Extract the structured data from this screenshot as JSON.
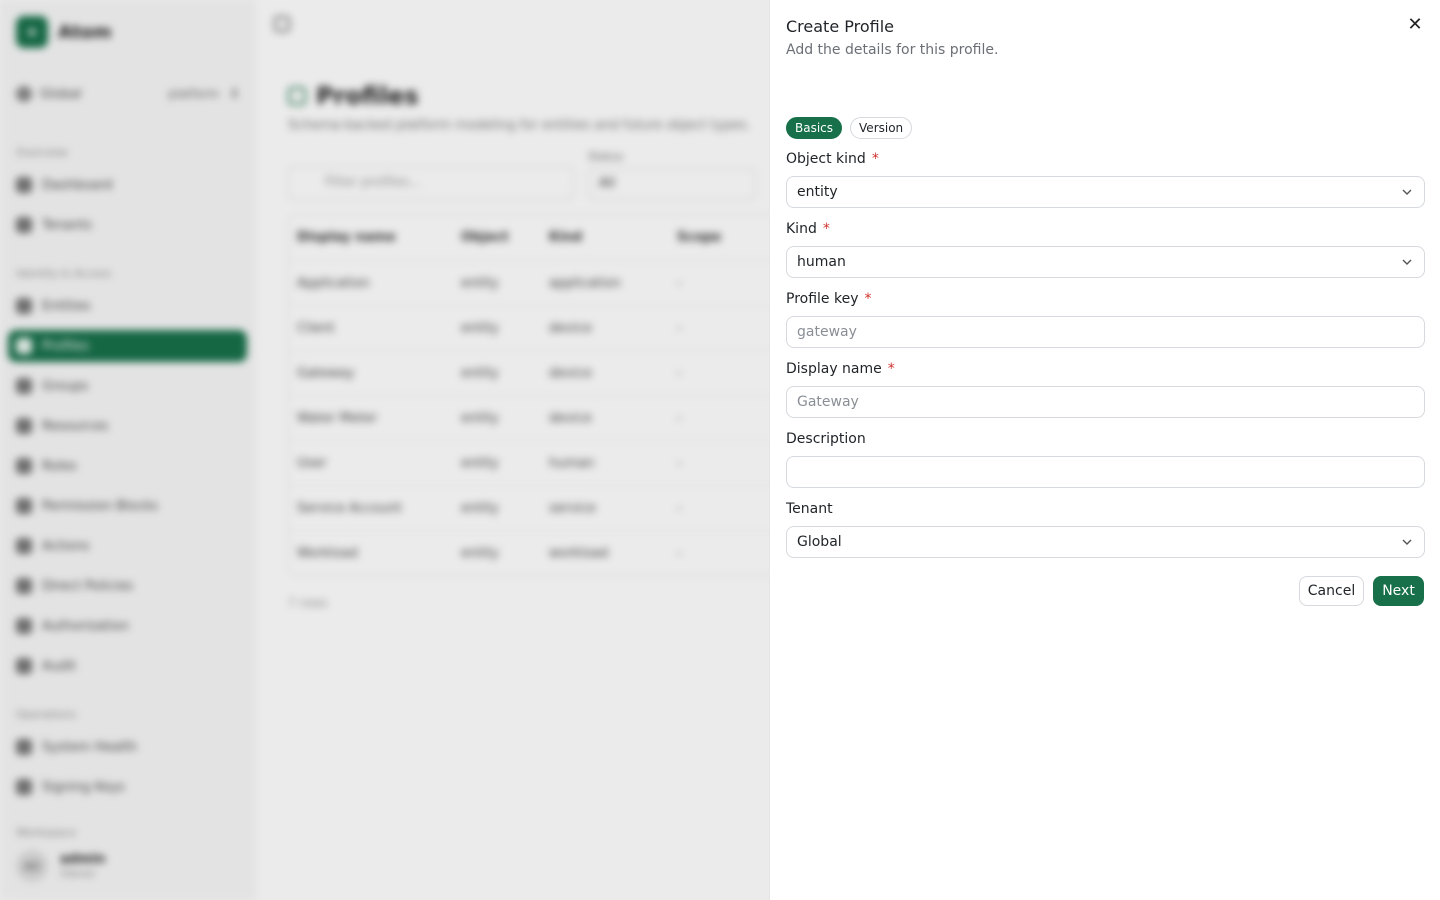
{
  "app": {
    "brand": "Atom",
    "scope": {
      "label": "Global",
      "tag": "platform"
    },
    "sections": {
      "overview": "Overview",
      "identity": "Identity & Access",
      "operations": "Operations",
      "workspace": "Workspace"
    },
    "nav": {
      "dashboard": "Dashboard",
      "tenants": "Tenants",
      "entities": "Entities",
      "profiles": "Profiles",
      "groups": "Groups",
      "resources": "Resources",
      "roles": "Roles",
      "permission_blocks": "Permission Blocks",
      "actions": "Actions",
      "direct_policies": "Direct Policies",
      "authorization": "Authorization",
      "audit": "Audit",
      "system_health": "System Health",
      "signing_keys": "Signing Keys"
    },
    "user": {
      "initials": "AD",
      "name": "admin",
      "role": "Owner"
    }
  },
  "page": {
    "title": "Profiles",
    "subtitle": "Schema-backed platform modeling for entities and future object types.",
    "filter_placeholder": "Filter profiles...",
    "status_label": "Status",
    "status_value": "All",
    "columns": [
      "Display name",
      "Object",
      "Kind",
      "Scope"
    ],
    "rows": [
      [
        "Application",
        "entity",
        "application",
        "-"
      ],
      [
        "Client",
        "entity",
        "device",
        "-"
      ],
      [
        "Gateway",
        "entity",
        "device",
        "-"
      ],
      [
        "Water Meter",
        "entity",
        "device",
        "-"
      ],
      [
        "User",
        "entity",
        "human",
        "-"
      ],
      [
        "Service Account",
        "entity",
        "service",
        "-"
      ],
      [
        "Workload",
        "entity",
        "workload",
        "-"
      ]
    ],
    "rows_count": "7 rows"
  },
  "sheet": {
    "title": "Create Profile",
    "description": "Add the details for this profile.",
    "close_icon": "close-icon",
    "steps": {
      "basics": "Basics",
      "version": "Version"
    },
    "fields": {
      "object_kind": {
        "label": "Object kind",
        "required": "*",
        "value": "entity"
      },
      "kind": {
        "label": "Kind",
        "required": "*",
        "value": "human"
      },
      "profile_key": {
        "label": "Profile key",
        "required": "*",
        "placeholder": "gateway",
        "value": ""
      },
      "display_name": {
        "label": "Display name",
        "required": "*",
        "placeholder": "Gateway",
        "value": ""
      },
      "description": {
        "label": "Description",
        "placeholder": "",
        "value": ""
      },
      "tenant": {
        "label": "Tenant",
        "value": "Global"
      }
    },
    "buttons": {
      "cancel": "Cancel",
      "next": "Next"
    }
  },
  "colors": {
    "accent": "#17704a",
    "required": "#d0312d",
    "border": "#d6d9dd",
    "muted_text": "#6b6f76"
  }
}
